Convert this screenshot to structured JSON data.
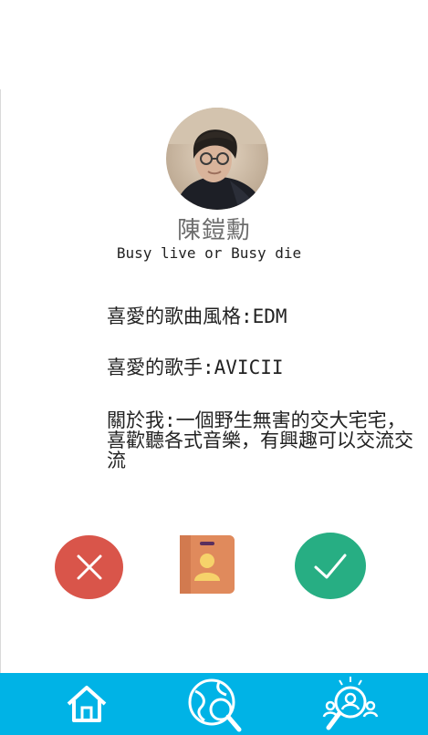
{
  "profile": {
    "name": "陳鎧勳",
    "motto": "Busy live or Busy die",
    "genre": "喜愛的歌曲風格:EDM",
    "singer": "喜愛的歌手:AVICII",
    "about": "關於我:一個野生無害的交大宅宅，喜歡聽各式音樂，有興趣可以交流交流"
  },
  "actions": {
    "reject_icon": "close-icon",
    "contact_icon": "contact-card-icon",
    "accept_icon": "check-icon"
  },
  "nav": {
    "items": [
      {
        "icon": "home-icon"
      },
      {
        "icon": "globe-search-icon"
      },
      {
        "icon": "people-search-icon"
      }
    ]
  },
  "colors": {
    "reject": "#d9554a",
    "contact": "#e08a5c",
    "accept": "#27ae83",
    "navbar": "#00b3e6"
  }
}
